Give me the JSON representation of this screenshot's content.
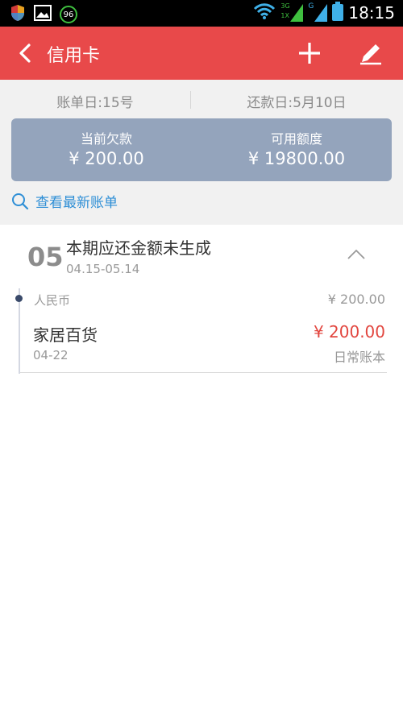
{
  "statusbar": {
    "battery_badge": "96",
    "network_3g": "3G",
    "network_1x": "1X",
    "network_g": "G",
    "time": "18:15"
  },
  "appbar": {
    "title": "信用卡",
    "back_icon": "chevron-left-icon",
    "add_icon": "plus-icon",
    "edit_icon": "pencil-icon",
    "color": "#e8494a"
  },
  "dates": {
    "statement_day": "账单日:15号",
    "due_day": "还款日:5月10日"
  },
  "summary": {
    "debt_label": "当前欠款",
    "debt_value": "¥ 200.00",
    "available_label": "可用额度",
    "available_value": "¥ 19800.00",
    "card_color": "#94a4bc"
  },
  "links": {
    "view_latest": "查看最新账单"
  },
  "bill": {
    "month": "05",
    "title": "本期应还金额未生成",
    "range": "04.15-05.14",
    "currency": "人民币",
    "currency_total": "¥ 200.00",
    "entries": [
      {
        "name": "家居百货",
        "amount": "¥ 200.00",
        "date": "04-22",
        "book": "日常账本",
        "amount_color": "#e2463f"
      }
    ]
  }
}
